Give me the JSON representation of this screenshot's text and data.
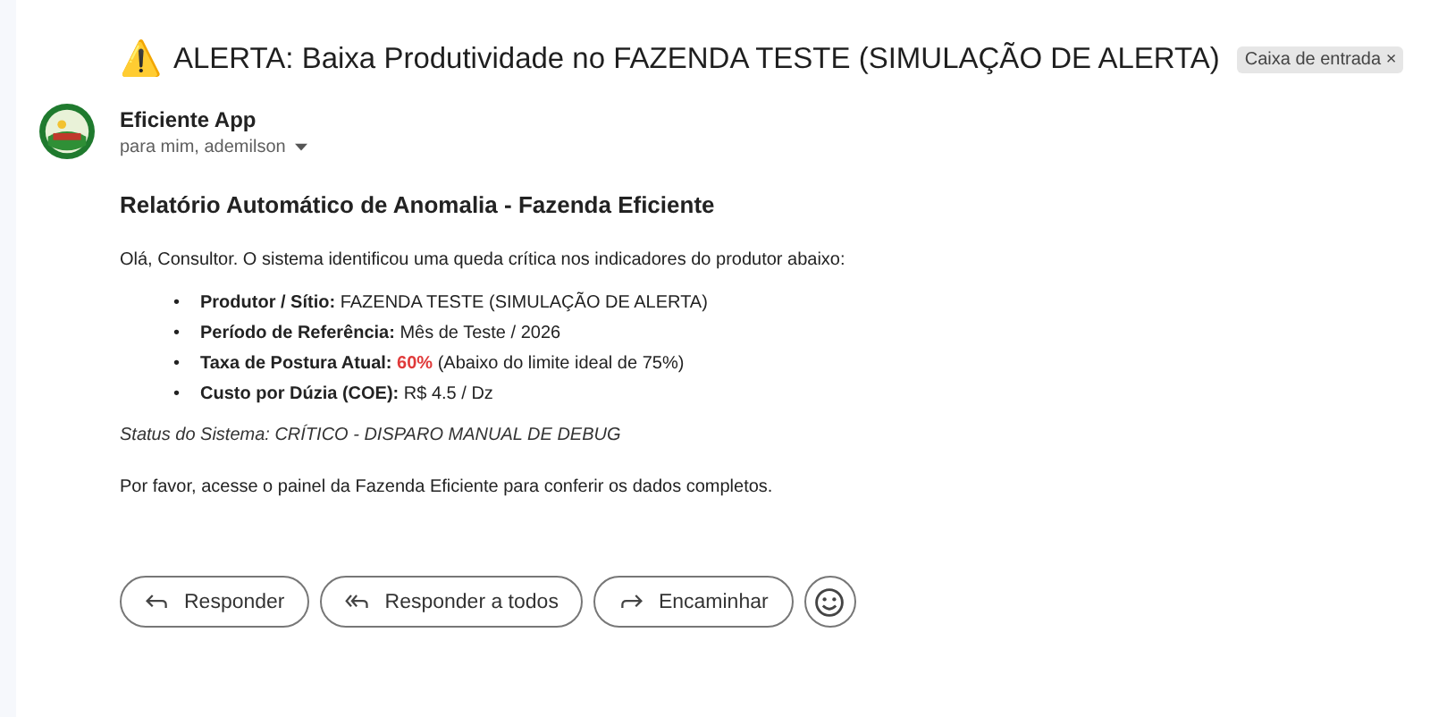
{
  "subject": {
    "icon": "⚠️",
    "title": "ALERTA: Baixa Produtividade no FAZENDA TESTE (SIMULAÇÃO DE ALERTA)",
    "label": "Caixa de entrada",
    "label_close": "×"
  },
  "sender": {
    "name": "Eficiente App",
    "to": "para mim, ademilson"
  },
  "body": {
    "heading": "Relatório Automático de Anomalia - Fazenda Eficiente",
    "intro": "Olá, Consultor. O sistema identificou uma queda crítica nos indicadores do produtor abaixo:",
    "items": [
      {
        "bullet": "•",
        "label": "Produtor / Sítio:",
        "value": "FAZENDA TESTE (SIMULAÇÃO DE ALERTA)"
      },
      {
        "bullet": "•",
        "label": "Período de Referência:",
        "value": "Mês de Teste / 2026"
      },
      {
        "bullet": "•",
        "label": "Taxa de Postura Atual:",
        "highlight": "60%",
        "value": "(Abaixo do limite ideal de 75%)"
      },
      {
        "bullet": "•",
        "label": "Custo por Dúzia (COE):",
        "value": "R$ 4.5 / Dz"
      }
    ],
    "status": "Status do Sistema: CRÍTICO - DISPARO MANUAL DE DEBUG",
    "closing": "Por favor, acesse o painel da Fazenda Eficiente para conferir os dados completos."
  },
  "actions": [
    {
      "kind": "reply",
      "label": "Responder"
    },
    {
      "kind": "reply_all",
      "label": "Responder a todos"
    },
    {
      "kind": "forward",
      "label": "Encaminhar"
    },
    {
      "kind": "emoji"
    }
  ]
}
